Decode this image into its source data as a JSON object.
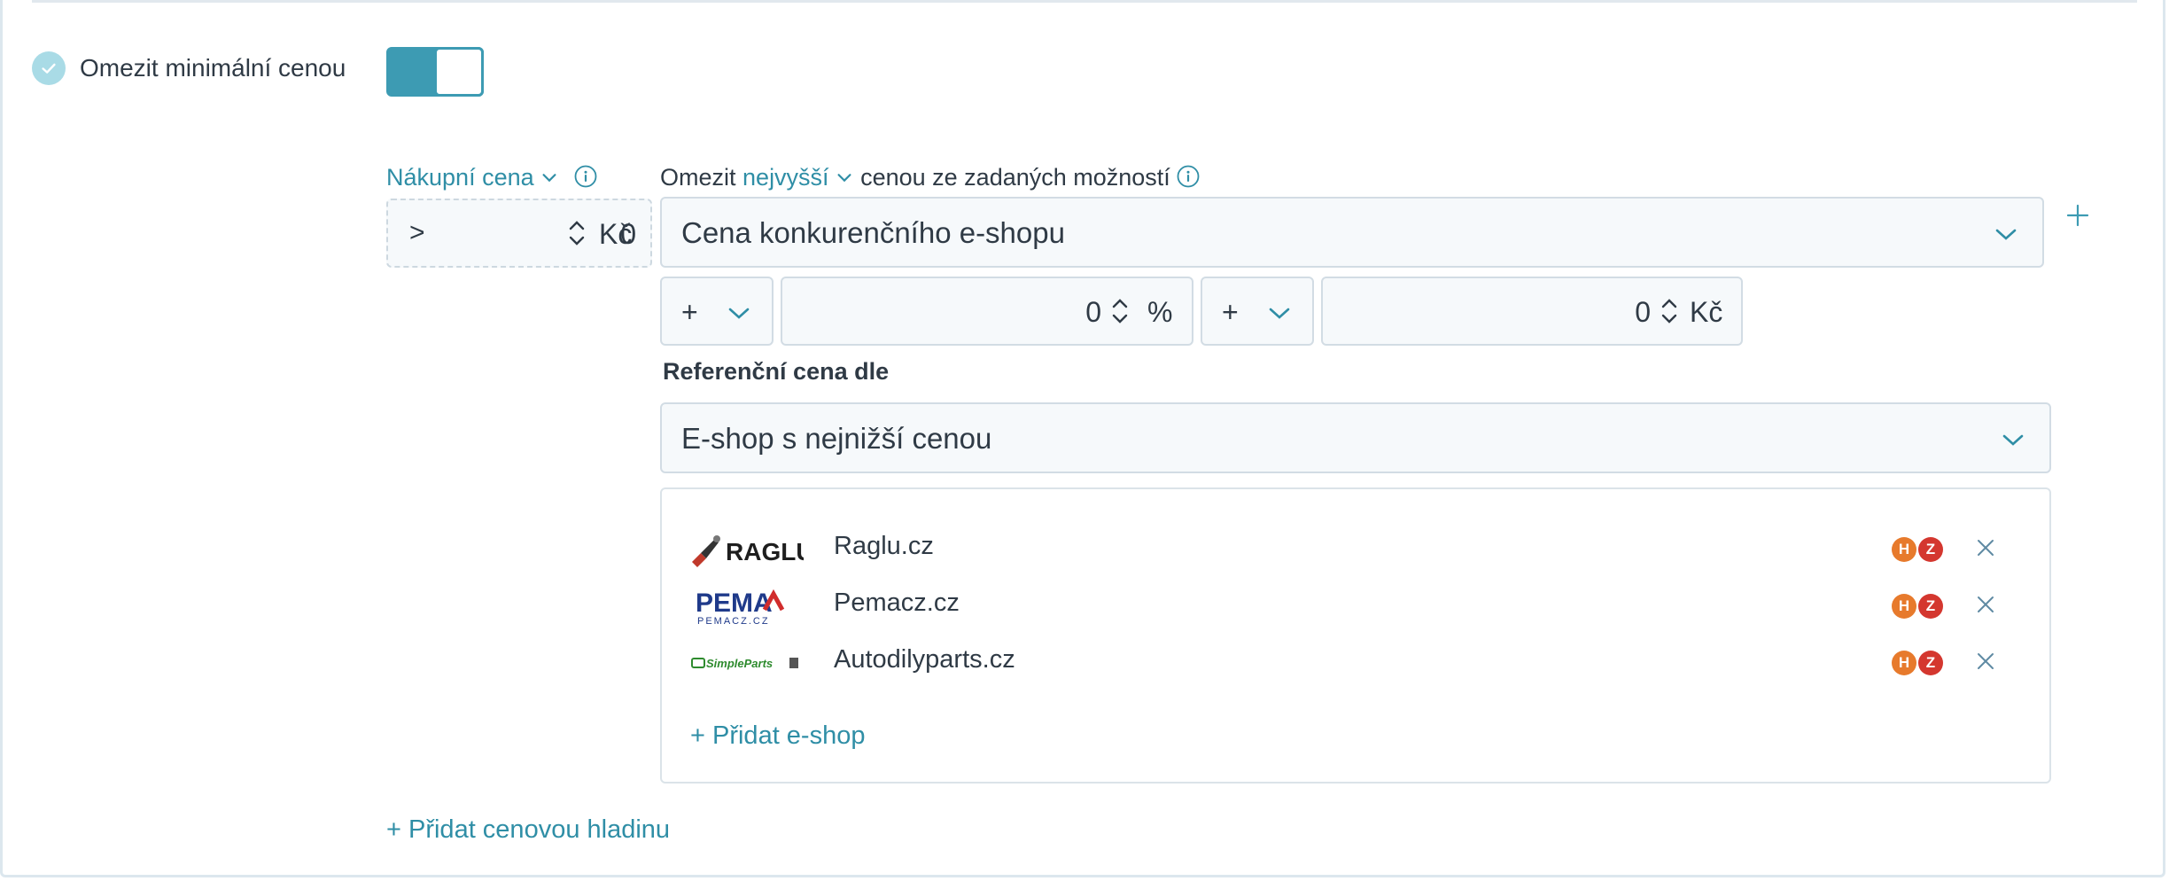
{
  "section": {
    "checkbox_label": "Omezit minimální cenou",
    "toggle_on": true
  },
  "purchase": {
    "label": "Nákupní cena",
    "operator": ">",
    "value": "0",
    "unit": "Kč"
  },
  "limit": {
    "prefix": "Omezit",
    "mode": "nejvyšší",
    "suffix": "cenou ze zadaných možností",
    "source": "Cena konkurenčního e-shopu",
    "adj1": {
      "sign": "+",
      "value": "0",
      "unit": "%"
    },
    "adj2": {
      "sign": "+",
      "value": "0",
      "unit": "Kč"
    }
  },
  "reference": {
    "label": "Referenční cena dle",
    "value": "E-shop s nejnižší cenou"
  },
  "shops": [
    {
      "name": "Raglu.cz",
      "logo_text": "RAGLU",
      "badges": [
        "H",
        "Z"
      ]
    },
    {
      "name": "Pemacz.cz",
      "logo_text": "PEMA",
      "logo_sub": "PEMACZ.CZ",
      "badges": [
        "H",
        "Z"
      ]
    },
    {
      "name": "Autodilyparts.cz",
      "logo_text": "SimpleParts",
      "badges": [
        "H",
        "Z"
      ]
    }
  ],
  "actions": {
    "add_shop": "+ Přidat e-shop",
    "add_level": "+ Přidat cenovou hladinu"
  },
  "colors": {
    "accent": "#3d9bb3",
    "link": "#2f8ea6",
    "badge_h": "#e77a2c",
    "badge_z": "#d4372f"
  }
}
